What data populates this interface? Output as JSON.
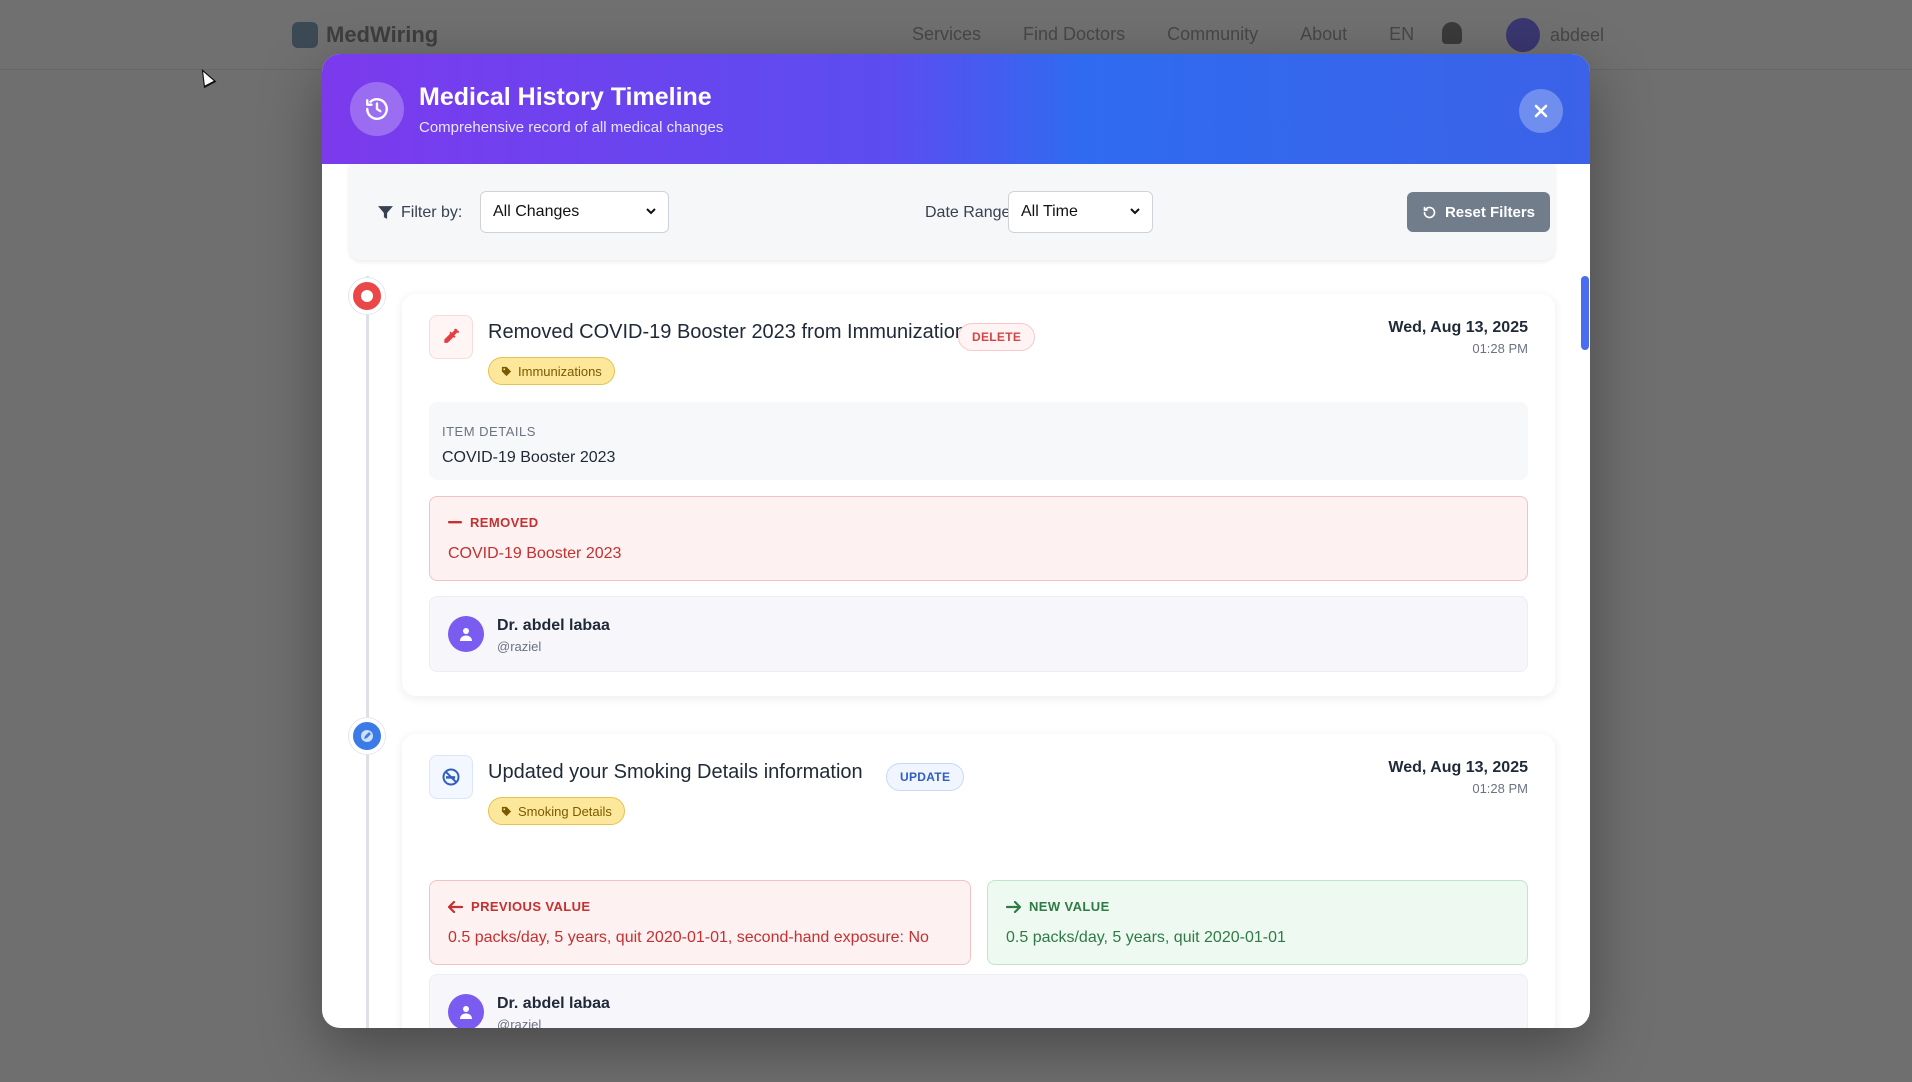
{
  "background": {
    "brand": "MedWiring",
    "nav_links": [
      "Services",
      "Find Doctors",
      "Community",
      "About"
    ],
    "language": "EN",
    "username": "abdeel"
  },
  "modal": {
    "title": "Medical History Timeline",
    "subtitle": "Comprehensive record of all medical changes",
    "icons": {
      "header": "history-icon",
      "close": "close-icon"
    }
  },
  "filters": {
    "filter_label": "Filter by:",
    "filter_value": "All Changes",
    "date_label": "Date Range:",
    "date_value": "All Time",
    "reset_label": "Reset Filters"
  },
  "entries": [
    {
      "title": "Removed COVID-19 Booster 2023 from Immunizations",
      "action": "DELETE",
      "category": "Immunizations",
      "date": "Wed, Aug 13, 2025",
      "time": "01:28 PM",
      "details_label": "ITEM DETAILS",
      "details_value": "COVID-19 Booster 2023",
      "removed_label": "REMOVED",
      "removed_value": "COVID-19 Booster 2023",
      "author_name": "Dr. abdel labaa",
      "author_handle": "@raziel",
      "icon": "syringe-icon",
      "color": "#ea4848"
    },
    {
      "title": "Updated your Smoking Details information",
      "action": "UPDATE",
      "category": "Smoking Details",
      "date": "Wed, Aug 13, 2025",
      "time": "01:28 PM",
      "prev_label": "PREVIOUS VALUE",
      "prev_value": "0.5 packs/day, 5 years, quit 2020-01-01, second-hand exposure: No",
      "new_label": "NEW VALUE",
      "new_value": "0.5 packs/day, 5 years, quit 2020-01-01",
      "author_name": "Dr. abdel labaa",
      "author_handle": "@raziel",
      "icon": "no-smoking-icon",
      "color": "#3b7be8"
    }
  ]
}
